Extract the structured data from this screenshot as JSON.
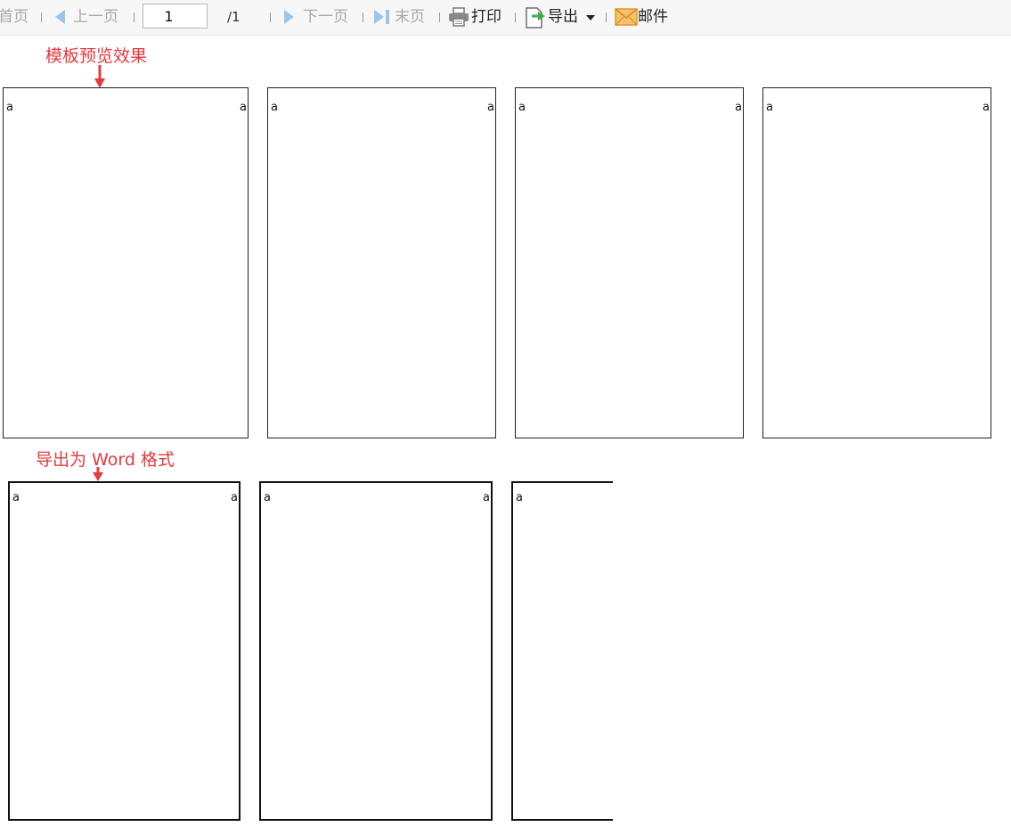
{
  "toolbar": {
    "first_label": "首页",
    "prev_label": "上一页",
    "page_value": "1",
    "page_total": "/1",
    "next_label": "下一页",
    "last_label": "末页",
    "print_label": "打印",
    "export_label": "导出",
    "mail_label": "邮件"
  },
  "annotations": {
    "top": "模板预览效果",
    "bottom": "导出为 Word 格式"
  },
  "pages": [
    {
      "left": "a",
      "right": "a"
    },
    {
      "left": "a",
      "right": "a"
    },
    {
      "left": "a",
      "right": "a"
    },
    {
      "left": "a",
      "right": "a"
    },
    {
      "left": "a",
      "right": "a"
    },
    {
      "left": "a",
      "right": "a"
    },
    {
      "left": "a"
    }
  ],
  "colors": {
    "annotation": "#e5393e",
    "nav_arrow": "#9cc4e8",
    "export_icon": "#3fae49",
    "mail_icon": "#f2a33a"
  }
}
